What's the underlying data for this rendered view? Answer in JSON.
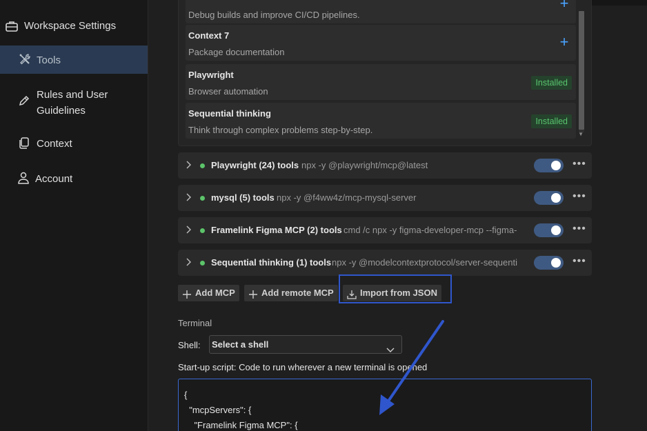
{
  "sidebar": {
    "items": [
      {
        "label": "Workspace Settings",
        "icon": "briefcase-icon"
      },
      {
        "label": "Tools",
        "icon": "wrench-screwdriver-icon",
        "active": true
      },
      {
        "label": "Rules and User Guidelines",
        "icon": "pencil-icon"
      },
      {
        "label": "Context",
        "icon": "copy-icon"
      },
      {
        "label": "Account",
        "icon": "person-icon"
      }
    ]
  },
  "registry": {
    "items": [
      {
        "title": "",
        "desc": "Debug builds and improve CI/CD pipelines.",
        "action": "add"
      },
      {
        "title": "Context 7",
        "desc": "Package documentation",
        "action": "add"
      },
      {
        "title": "Playwright",
        "desc": "Browser automation",
        "action": "Installed"
      },
      {
        "title": "Sequential thinking",
        "desc": "Think through complex problems step-by-step.",
        "action": "Installed"
      }
    ]
  },
  "tools": [
    {
      "name": "Playwright (24) tools",
      "cmd": "npx -y @playwright/mcp@latest",
      "enabled": true
    },
    {
      "name": "mysql (5) tools",
      "cmd": "npx -y @f4ww4z/mcp-mysql-server",
      "enabled": true
    },
    {
      "name": "Framelink Figma MCP (2) tools",
      "cmd": "cmd /c npx -y figma-developer-mcp --figma-",
      "enabled": true
    },
    {
      "name": "Sequential thinking (1) tools",
      "cmd": "npx -y @modelcontextprotocol/server-sequenti",
      "enabled": true
    }
  ],
  "actions": {
    "add_mcp": "Add MCP",
    "add_remote_mcp": "Add remote MCP",
    "import_json": "Import from JSON"
  },
  "terminal": {
    "section_title": "Terminal",
    "shell_label": "Shell:",
    "shell_value": "Select a shell",
    "startup_label": "Start-up script: Code to run wherever a new terminal is opened",
    "script_lines": [
      "{",
      "  \"mcpServers\": {",
      "    \"Framelink Figma MCP\": {"
    ]
  },
  "colors": {
    "accent": "#3b6bd1",
    "installed": "#59c46f",
    "highlight": "#2f56cc"
  }
}
